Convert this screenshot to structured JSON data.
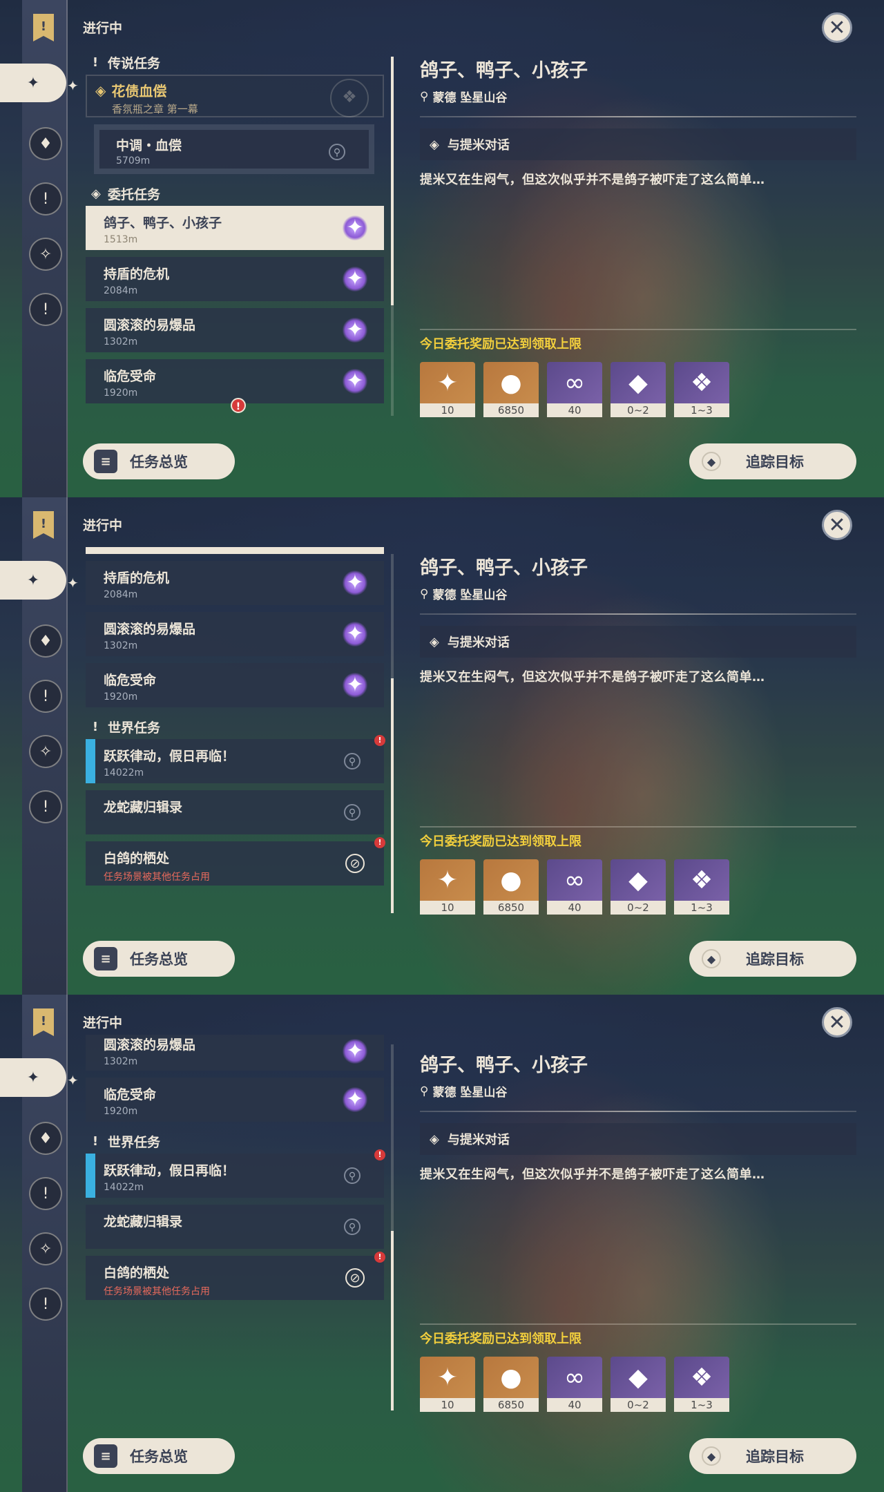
{
  "header": {
    "title": "进行中",
    "close_icon": "✕"
  },
  "rail": [
    "!",
    "✧",
    "⟡",
    "!",
    "✦",
    "!"
  ],
  "sections": {
    "legend": "传说任务",
    "commission": "委托任务",
    "world": "世界任务"
  },
  "legend_quest": {
    "title": "花债血偿",
    "subtitle": "香氛瓶之章 第一幕",
    "sub_title": "中调・血偿",
    "sub_distance": "5709m"
  },
  "commissions": [
    {
      "title": "鸽子、鸭子、小孩子",
      "distance": "1513m"
    },
    {
      "title": "持盾的危机",
      "distance": "2084m"
    },
    {
      "title": "圆滚滚的易爆品",
      "distance": "1302m"
    },
    {
      "title": "临危受命",
      "distance": "1920m"
    }
  ],
  "world_quests": [
    {
      "title": "跃跃律动，假日再临！",
      "distance": "14022m"
    },
    {
      "title": "龙蛇藏归辑录",
      "distance": ""
    },
    {
      "title": "白鸽的栖处",
      "distance": "任务场景被其他任务占用"
    }
  ],
  "detail": {
    "title": "鸽子、鸭子、小孩子",
    "location": "蒙德 坠星山谷",
    "objective": "与提米对话",
    "description": "提米又在生闷气，但这次似乎并不是鸽子被吓走了这么简单…",
    "limit_text": "今日委托奖励已达到领取上限",
    "rewards": [
      {
        "name": "adventure-exp",
        "count": "10"
      },
      {
        "name": "mora",
        "count": "6850"
      },
      {
        "name": "friendship-exp",
        "count": "40"
      },
      {
        "name": "crystal-fragment",
        "count": "0~2"
      },
      {
        "name": "crystal-cluster",
        "count": "1~3"
      }
    ]
  },
  "buttons": {
    "overview": "任务总览",
    "track": "追踪目标"
  }
}
